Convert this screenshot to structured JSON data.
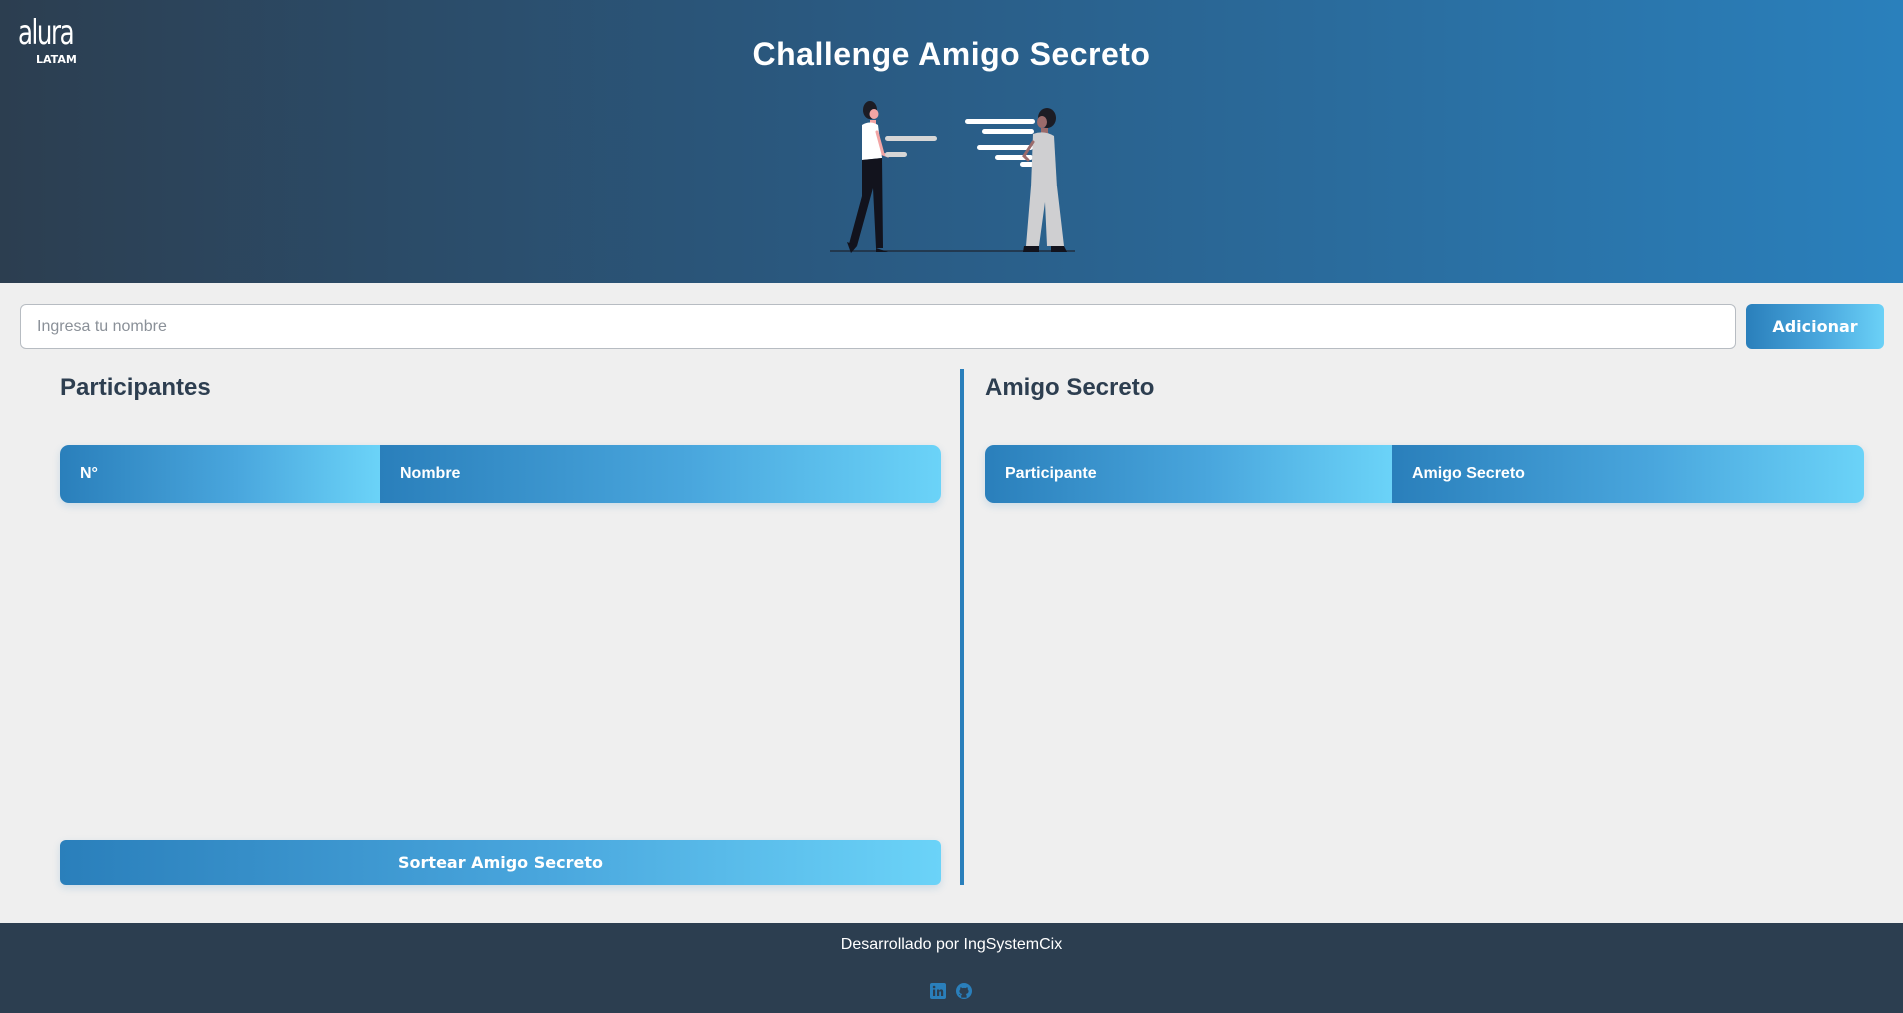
{
  "header": {
    "logo_main": "alura",
    "logo_sub": "LATAM",
    "title": "Challenge Amigo Secreto"
  },
  "input_row": {
    "placeholder": "Ingresa tu nombre",
    "value": "",
    "add_label": "Adicionar"
  },
  "participants": {
    "title": "Participantes",
    "columns": [
      "N°",
      "Nombre"
    ],
    "rows": [],
    "draw_label": "Sortear Amigo Secreto"
  },
  "secret_friend": {
    "title": "Amigo Secreto",
    "columns": [
      "Participante",
      "Amigo Secreto"
    ],
    "rows": []
  },
  "footer": {
    "text": "Desarrollado por IngSystemCix",
    "icons": [
      "linkedin-icon",
      "github-icon"
    ]
  },
  "colors": {
    "header_dark": "#2c3e50",
    "accent_blue": "#2a7fbb",
    "accent_light": "#6bd3f8",
    "background": "#efefef"
  }
}
